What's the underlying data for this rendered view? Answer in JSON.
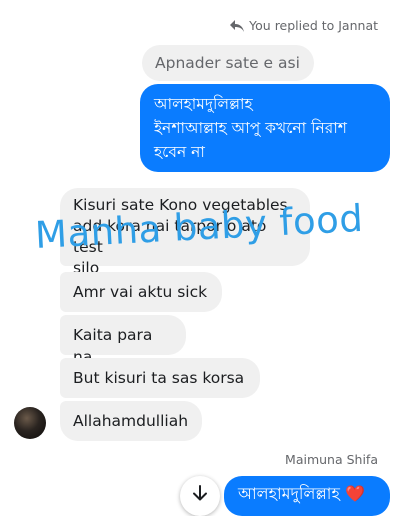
{
  "reply_note": {
    "text": "You replied to Jannat",
    "icon": "reply-arrow-icon"
  },
  "quoted_message": "Apnader sate e asi",
  "outgoing_1": {
    "line1": "আলহামদুলিল্লাহ",
    "line2": "ইনশাআল্লাহ আপু কখনো নিরাশ",
    "line3": "হবেন না"
  },
  "incoming": [
    {
      "line1": "Kisuri sate Kono vegetables",
      "line2": "add kora nai tarpor o ato test",
      "line3": "silo"
    },
    {
      "text": "Amr vai aktu sick"
    },
    {
      "text": "Kaita para na"
    },
    {
      "text": "But kisuri ta sas korsa"
    },
    {
      "text": "Allahamdulliah"
    }
  ],
  "watermark": "Manha baby food",
  "sender_name": "Maimuna Shifa",
  "outgoing_2": {
    "text": "আলহামদুলিল্লাহ",
    "emoji": "❤️"
  },
  "colors": {
    "outgoing_bubble": "#0a7cff",
    "incoming_bubble": "#f0f0f0",
    "watermark": "#2f9ee6"
  }
}
